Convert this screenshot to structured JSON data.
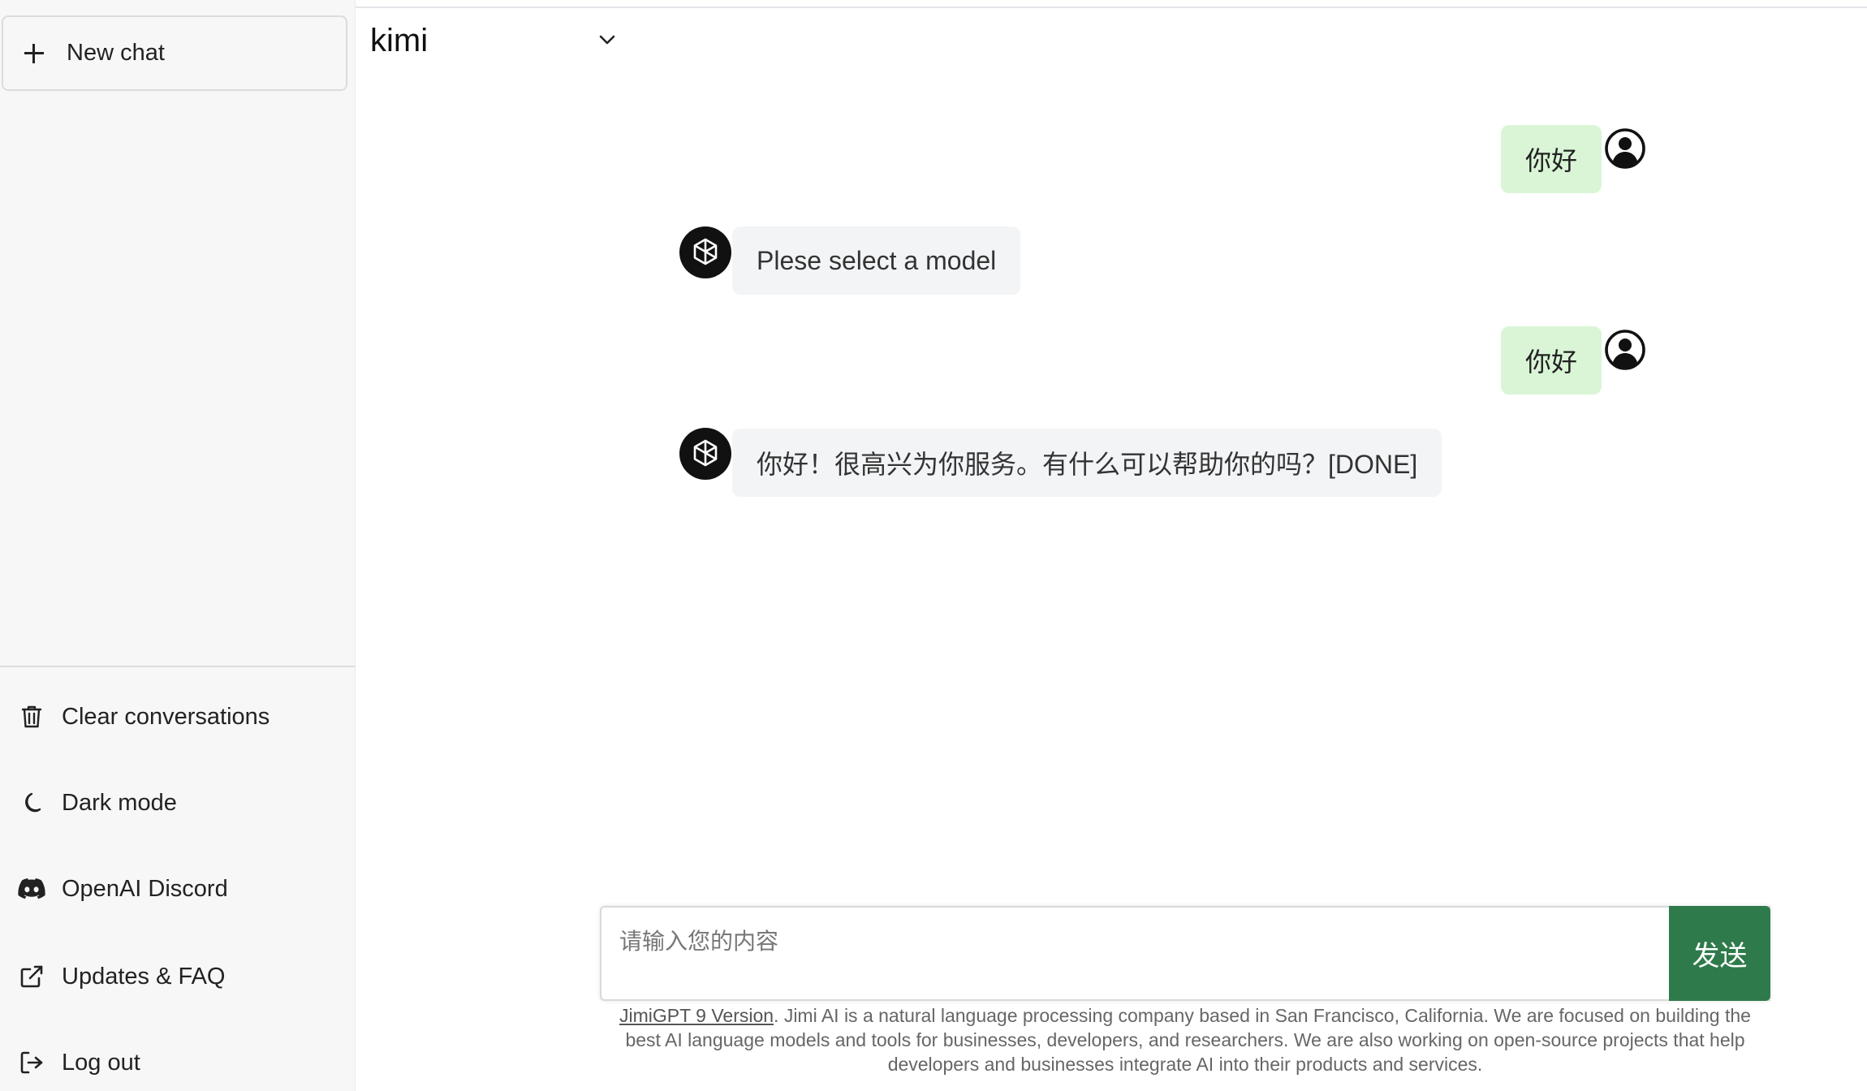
{
  "sidebar": {
    "new_chat_label": "New chat",
    "items": [
      {
        "label": "Clear conversations",
        "icon": "trash-icon"
      },
      {
        "label": "Dark mode",
        "icon": "moon-icon"
      },
      {
        "label": "OpenAI Discord",
        "icon": "discord-icon"
      },
      {
        "label": "Updates & FAQ",
        "icon": "external-link-icon"
      },
      {
        "label": "Log out",
        "icon": "logout-icon"
      }
    ]
  },
  "header": {
    "model_value": "kimi"
  },
  "messages": [
    {
      "role": "user",
      "text": "你好"
    },
    {
      "role": "assistant",
      "text": "Plese select a model"
    },
    {
      "role": "user",
      "text": "你好"
    },
    {
      "role": "assistant",
      "text": "你好！很高兴为你服务。有什么可以帮助你的吗？[DONE]"
    }
  ],
  "composer": {
    "placeholder": "请输入您的内容",
    "value": "",
    "send_label": "发送"
  },
  "footer": {
    "version_link": "JimiGPT 9 Version",
    "text": ". Jimi AI is a natural language processing company based in San Francisco, California. We are focused on building the best AI language models and tools for businesses, developers, and researchers. We are also working on open-source projects that help developers and businesses integrate AI into their products and services."
  },
  "colors": {
    "user_bubble": "#d9f5d6",
    "assistant_bubble": "#f3f4f6",
    "send_button": "#2e7a4a",
    "sidebar_bg": "#f7f7f7"
  }
}
